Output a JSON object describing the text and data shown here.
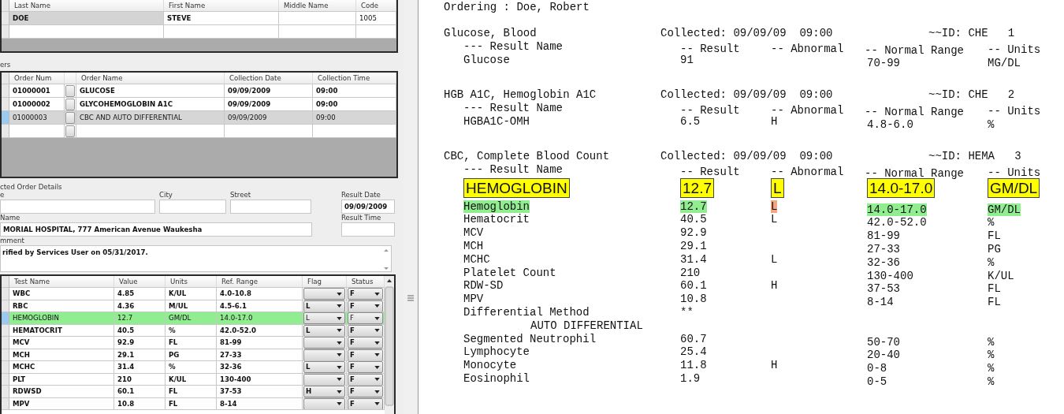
{
  "patient_grid": {
    "columns": [
      "Last Name",
      "First Name",
      "Middle Name",
      "Code"
    ],
    "rows": [
      {
        "last_name": "DOE",
        "first_name": "STEVE",
        "code": "1005"
      }
    ]
  },
  "orders": {
    "group_label": "ers",
    "columns": [
      "Order Num",
      "Order Name",
      "Collection Date",
      "Collection Time"
    ],
    "rows": [
      {
        "order_num": "01000001",
        "order_name": "GLUCOSE",
        "collection_date": "09/09/2009",
        "collection_time": "09:00",
        "selected": false
      },
      {
        "order_num": "01000002",
        "order_name": "GLYCOHEMOGLOBIN A1C",
        "collection_date": "09/09/2009",
        "collection_time": "09:00",
        "selected": false
      },
      {
        "order_num": "01000003",
        "order_name": "CBC AND AUTO DIFFERENTIAL",
        "collection_date": "09/09/2009",
        "collection_time": "09:00",
        "selected": true
      }
    ]
  },
  "details": {
    "group_label": "cted Order Details",
    "name_label": "e",
    "city_label": "City",
    "street_label": "Street",
    "result_date_label": "Result Date",
    "result_date": "09/09/2009",
    "facility_label": "Name",
    "facility": "MORIAL HOSPITAL, 777 American Avenue Waukesha",
    "result_time_label": "Result Time",
    "comment_label": "mment",
    "comment": "rified by Services User on 05/31/2017."
  },
  "tests": {
    "columns": [
      "Test Name",
      "Value",
      "Units",
      "Ref. Range",
      "Flag",
      "Status"
    ],
    "rows": [
      {
        "name": "WBC",
        "value": "4.85",
        "units": "K/UL",
        "range": "4.0-10.8",
        "status": "F",
        "selected": false
      },
      {
        "name": "RBC",
        "value": "4.36",
        "units": "M/UL",
        "range": "4.5-6.1",
        "flag": "L",
        "status": "F",
        "selected": false
      },
      {
        "name": "HEMOGLOBIN",
        "value": "12.7",
        "units": "GM/DL",
        "range": "14.0-17.0",
        "flag": "L",
        "status": "F",
        "selected": true
      },
      {
        "name": "HEMATOCRIT",
        "value": "40.5",
        "units": "%",
        "range": "42.0-52.0",
        "flag": "L",
        "status": "F",
        "selected": false
      },
      {
        "name": "MCV",
        "value": "92.9",
        "units": "FL",
        "range": "81-99",
        "status": "F",
        "selected": false
      },
      {
        "name": "MCH",
        "value": "29.1",
        "units": "PG",
        "range": "27-33",
        "status": "F",
        "selected": false
      },
      {
        "name": "MCHC",
        "value": "31.4",
        "units": "%",
        "range": "32-36",
        "flag": "L",
        "status": "F",
        "selected": false
      },
      {
        "name": "PLT",
        "value": "210",
        "units": "K/UL",
        "range": "130-400",
        "status": "F",
        "selected": false
      },
      {
        "name": "RDWSD",
        "value": "60.1",
        "units": "FL",
        "range": "37-53",
        "flag": "H",
        "status": "F",
        "selected": false
      },
      {
        "name": "MPV",
        "value": "10.8",
        "units": "FL",
        "range": "8-14",
        "status": "F",
        "selected": false
      }
    ]
  },
  "document": {
    "ordering": "Ordering : Doe, Robert",
    "sections": [
      {
        "title": "Glucose, Blood",
        "collected": "Collected: 09/09/09  09:00",
        "id": "~~ID: CHE   1",
        "headers": {
          "name": "--- Result Name",
          "result": "-- Result",
          "abnormal": "-- Abnormal",
          "range": "-- Normal Range",
          "units": "-- Units"
        },
        "rows": [
          {
            "kind": "result",
            "name": "Glucose",
            "result": "91",
            "range": "70-99",
            "units": "MG/DL",
            "highlighted": false
          }
        ]
      },
      {
        "title": "HGB A1C, Hemoglobin A1C",
        "collected": "Collected: 09/09/09  09:00",
        "id": "~~ID: CHE   2",
        "headers": {
          "name": "--- Result Name",
          "result": "-- Result",
          "abnormal": "-- Abnormal",
          "range": "-- Normal Range",
          "units": "-- Units"
        },
        "rows": [
          {
            "kind": "result",
            "name": "HGBA1C-OMH",
            "result": "6.5",
            "abnormal": "H",
            "range": "4.8-6.0",
            "units": "%",
            "highlighted": false
          }
        ]
      },
      {
        "title": "CBC, Complete Blood Count",
        "collected": "Collected: 09/09/09  09:00",
        "id": "~~ID: HEMA   3",
        "headers": {
          "name": "--- Result Name",
          "result": "-- Result",
          "abnormal": "-- Abnormal",
          "range": "-- Normal Range",
          "units": "-- Units"
        },
        "callouts": [
          "HEMOGLOBIN",
          "12.7",
          "L",
          "14.0-17.0",
          "GM/DL"
        ],
        "rows": [
          {
            "kind": "result",
            "name": "Hemoglobin",
            "result": "12.7",
            "abnormal": "L",
            "range": "14.0-17.0",
            "units": "GM/DL",
            "highlighted": true
          },
          {
            "kind": "result",
            "name": "Hematocrit",
            "result": "40.5",
            "abnormal": "L",
            "range": "42.0-52.0",
            "units": "%",
            "highlighted": false
          },
          {
            "kind": "result",
            "name": "MCV",
            "result": "92.9",
            "range": "81-99",
            "units": "FL",
            "highlighted": false
          },
          {
            "kind": "result",
            "name": "MCH",
            "result": "29.1",
            "range": "27-33",
            "units": "PG",
            "highlighted": false
          },
          {
            "kind": "result",
            "name": "MCHC",
            "result": "31.4",
            "abnormal": "L",
            "range": "32-36",
            "units": "%",
            "highlighted": false
          },
          {
            "kind": "result",
            "name": "Platelet Count",
            "result": "210",
            "range": "130-400",
            "units": "K/UL",
            "highlighted": false
          },
          {
            "kind": "result",
            "name": "RDW-SD",
            "result": "60.1",
            "abnormal": "H",
            "range": "37-53",
            "units": "FL",
            "highlighted": false
          },
          {
            "kind": "result",
            "name": "MPV",
            "result": "10.8",
            "range": "8-14",
            "units": "FL",
            "highlighted": false
          },
          {
            "kind": "result",
            "name": "Differential Method",
            "result": "**",
            "highlighted": false
          },
          {
            "kind": "note",
            "text": "AUTO DIFFERENTIAL"
          },
          {
            "kind": "result",
            "name": "Segmented Neutrophil",
            "result": "60.7",
            "range": "50-70",
            "units": "%",
            "highlighted": false
          },
          {
            "kind": "result",
            "name": "Lymphocyte",
            "result": "25.4",
            "range": "20-40",
            "units": "%",
            "highlighted": false
          },
          {
            "kind": "result",
            "name": "Monocyte",
            "result": "11.8",
            "abnormal": "H",
            "range": "0-8",
            "units": "%",
            "highlighted": false
          },
          {
            "kind": "result",
            "name": "Eosinophil",
            "result": "1.9",
            "range": "0-5",
            "units": "%",
            "highlighted": false
          }
        ]
      }
    ]
  }
}
